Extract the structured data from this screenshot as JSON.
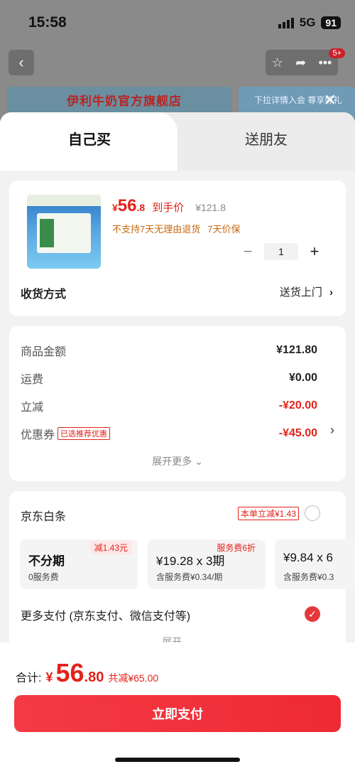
{
  "status": {
    "time": "15:58",
    "network": "5G",
    "battery": "91"
  },
  "background": {
    "shop_banner": "伊利牛奶官方旗舰店",
    "promo_banner": "下拉详情入会 尊享好礼",
    "message_badge": "5+"
  },
  "tabs": [
    {
      "label": "自己买"
    },
    {
      "label": "送朋友"
    }
  ],
  "product": {
    "currency": "¥",
    "price_int": "56",
    "price_dec": ".8",
    "price_note": "到手价",
    "original_price": "¥121.8",
    "policies": [
      "不支持7天无理由退货",
      "7天价保"
    ],
    "quantity": "1"
  },
  "shipping": {
    "label": "收货方式",
    "value": "送货上门"
  },
  "summary": {
    "rows": [
      {
        "label": "商品金额",
        "value": "¥121.80"
      },
      {
        "label": "运费",
        "value": "¥0.00"
      },
      {
        "label": "立减",
        "value": "-¥20.00"
      },
      {
        "label": "优惠券",
        "tag": "已选推荐优惠",
        "value": "-¥45.00"
      }
    ],
    "expand": "展开更多"
  },
  "payment": {
    "baitiao": {
      "title": "京东白条",
      "tag": "本单立减¥1.43"
    },
    "plans": [
      {
        "title": "不分期",
        "sub": "0服务费",
        "badge": "减1.43元"
      },
      {
        "title": "¥19.28 x 3期",
        "sub": "含服务费¥0.34/期",
        "badge": "服务费6折"
      },
      {
        "title": "¥9.84 x 6",
        "sub": "含服务费¥0.3",
        "badge": ""
      }
    ],
    "more": "更多支付 (京东支付、微信支付等)",
    "expand": "展开"
  },
  "footer": {
    "total_label": "合计:",
    "currency": "¥",
    "total_int": "56",
    "total_dec": ".80",
    "savings": "共减¥65.00",
    "pay_button": "立即支付"
  },
  "colors": {
    "accent": "#e2231a",
    "button": "#f43a44",
    "warning_text": "#c8690f"
  }
}
